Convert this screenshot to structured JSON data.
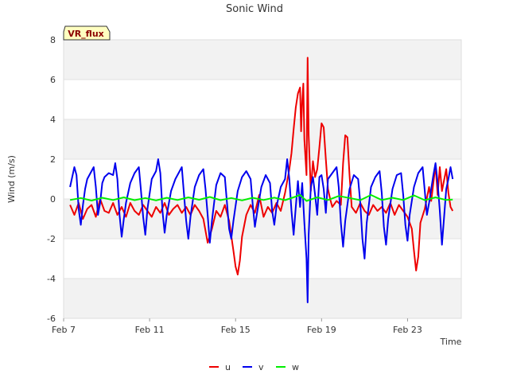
{
  "chart_data": {
    "type": "line",
    "title": "Sonic Wind",
    "xlabel": "Time",
    "ylabel": "Wind (m/s)",
    "badge": "VR_flux",
    "ylim": [
      -6,
      8
    ],
    "xlim": [
      0,
      18.5
    ],
    "yticks": [
      -6,
      -4,
      -2,
      0,
      2,
      4,
      6,
      8
    ],
    "xticks": [
      {
        "value": 0,
        "label": "Feb 7"
      },
      {
        "value": 4,
        "label": "Feb 11"
      },
      {
        "value": 8,
        "label": "Feb 15"
      },
      {
        "value": 12,
        "label": "Feb 19"
      },
      {
        "value": 16,
        "label": "Feb 23"
      }
    ],
    "grid": "alternating horizontal bands",
    "legend_position": "bottom-center",
    "series": [
      {
        "name": "u",
        "color": "#ee0000",
        "points": [
          [
            0.3,
            -0.3
          ],
          [
            0.5,
            -0.8
          ],
          [
            0.7,
            -0.2
          ],
          [
            0.9,
            -1.0
          ],
          [
            1.1,
            -0.5
          ],
          [
            1.3,
            -0.3
          ],
          [
            1.5,
            -0.9
          ],
          [
            1.7,
            0.0
          ],
          [
            1.9,
            -0.6
          ],
          [
            2.1,
            -0.7
          ],
          [
            2.3,
            -0.2
          ],
          [
            2.5,
            -0.8
          ],
          [
            2.7,
            -0.4
          ],
          [
            2.9,
            -0.9
          ],
          [
            3.1,
            -0.2
          ],
          [
            3.3,
            -0.6
          ],
          [
            3.5,
            -0.8
          ],
          [
            3.7,
            -0.3
          ],
          [
            3.9,
            -0.6
          ],
          [
            4.1,
            -0.9
          ],
          [
            4.3,
            -0.4
          ],
          [
            4.5,
            -0.7
          ],
          [
            4.7,
            -0.2
          ],
          [
            4.9,
            -0.8
          ],
          [
            5.1,
            -0.5
          ],
          [
            5.3,
            -0.3
          ],
          [
            5.5,
            -0.7
          ],
          [
            5.7,
            -0.4
          ],
          [
            5.9,
            -0.8
          ],
          [
            6.1,
            -0.3
          ],
          [
            6.3,
            -0.6
          ],
          [
            6.5,
            -1.0
          ],
          [
            6.7,
            -2.2
          ],
          [
            6.9,
            -1.5
          ],
          [
            7.1,
            -0.6
          ],
          [
            7.3,
            -0.9
          ],
          [
            7.5,
            -0.3
          ],
          [
            7.7,
            -1.1
          ],
          [
            7.9,
            -2.6
          ],
          [
            8.0,
            -3.4
          ],
          [
            8.1,
            -3.8
          ],
          [
            8.2,
            -3.1
          ],
          [
            8.3,
            -1.9
          ],
          [
            8.5,
            -0.8
          ],
          [
            8.7,
            -0.3
          ],
          [
            8.9,
            -0.7
          ],
          [
            9.1,
            0.2
          ],
          [
            9.3,
            -0.9
          ],
          [
            9.5,
            -0.4
          ],
          [
            9.7,
            -0.7
          ],
          [
            9.9,
            -0.2
          ],
          [
            10.1,
            -0.6
          ],
          [
            10.3,
            0.3
          ],
          [
            10.5,
            1.5
          ],
          [
            10.6,
            2.3
          ],
          [
            10.7,
            3.5
          ],
          [
            10.8,
            4.6
          ],
          [
            10.9,
            5.3
          ],
          [
            11.0,
            5.6
          ],
          [
            11.05,
            3.4
          ],
          [
            11.1,
            4.9
          ],
          [
            11.15,
            5.8
          ],
          [
            11.2,
            3.0
          ],
          [
            11.3,
            1.2
          ],
          [
            11.35,
            7.1
          ],
          [
            11.4,
            3.2
          ],
          [
            11.5,
            0.4
          ],
          [
            11.6,
            1.9
          ],
          [
            11.7,
            1.1
          ],
          [
            11.8,
            1.5
          ],
          [
            11.9,
            2.6
          ],
          [
            12.0,
            3.8
          ],
          [
            12.1,
            3.6
          ],
          [
            12.2,
            2.0
          ],
          [
            12.3,
            0.5
          ],
          [
            12.4,
            0.0
          ],
          [
            12.5,
            -0.4
          ],
          [
            12.7,
            -0.1
          ],
          [
            12.9,
            -0.3
          ],
          [
            13.0,
            1.8
          ],
          [
            13.1,
            3.2
          ],
          [
            13.2,
            3.1
          ],
          [
            13.3,
            1.2
          ],
          [
            13.4,
            -0.4
          ],
          [
            13.6,
            -0.7
          ],
          [
            13.8,
            -0.2
          ],
          [
            14.0,
            -0.6
          ],
          [
            14.2,
            -0.8
          ],
          [
            14.4,
            -0.3
          ],
          [
            14.6,
            -0.6
          ],
          [
            14.8,
            -0.4
          ],
          [
            15.0,
            -0.7
          ],
          [
            15.2,
            -0.2
          ],
          [
            15.4,
            -0.8
          ],
          [
            15.6,
            -0.3
          ],
          [
            15.8,
            -0.6
          ],
          [
            16.0,
            -0.9
          ],
          [
            16.2,
            -1.5
          ],
          [
            16.3,
            -2.6
          ],
          [
            16.4,
            -3.6
          ],
          [
            16.5,
            -2.9
          ],
          [
            16.6,
            -1.2
          ],
          [
            16.8,
            -0.5
          ],
          [
            17.0,
            0.6
          ],
          [
            17.1,
            -0.1
          ],
          [
            17.3,
            1.7
          ],
          [
            17.4,
            0.2
          ],
          [
            17.5,
            1.6
          ],
          [
            17.6,
            0.4
          ],
          [
            17.8,
            1.5
          ],
          [
            17.9,
            0.3
          ],
          [
            18.0,
            -0.4
          ],
          [
            18.1,
            -0.6
          ]
        ]
      },
      {
        "name": "v",
        "color": "#0000ee",
        "points": [
          [
            0.3,
            0.6
          ],
          [
            0.5,
            1.6
          ],
          [
            0.6,
            1.2
          ],
          [
            0.7,
            -0.5
          ],
          [
            0.8,
            -1.3
          ],
          [
            0.9,
            -0.3
          ],
          [
            1.0,
            0.5
          ],
          [
            1.1,
            1.0
          ],
          [
            1.3,
            1.4
          ],
          [
            1.4,
            1.6
          ],
          [
            1.5,
            0.6
          ],
          [
            1.6,
            -0.8
          ],
          [
            1.7,
            -0.2
          ],
          [
            1.8,
            0.8
          ],
          [
            1.9,
            1.1
          ],
          [
            2.1,
            1.3
          ],
          [
            2.3,
            1.2
          ],
          [
            2.4,
            1.8
          ],
          [
            2.5,
            1.0
          ],
          [
            2.6,
            -0.8
          ],
          [
            2.7,
            -1.9
          ],
          [
            2.8,
            -1.0
          ],
          [
            2.9,
            -0.2
          ],
          [
            3.1,
            0.8
          ],
          [
            3.3,
            1.3
          ],
          [
            3.5,
            1.6
          ],
          [
            3.6,
            0.4
          ],
          [
            3.7,
            -0.9
          ],
          [
            3.8,
            -1.8
          ],
          [
            3.9,
            -0.5
          ],
          [
            4.1,
            1.0
          ],
          [
            4.3,
            1.4
          ],
          [
            4.4,
            2.0
          ],
          [
            4.5,
            1.3
          ],
          [
            4.6,
            -0.6
          ],
          [
            4.7,
            -1.7
          ],
          [
            4.8,
            -0.8
          ],
          [
            5.0,
            0.4
          ],
          [
            5.2,
            1.0
          ],
          [
            5.4,
            1.4
          ],
          [
            5.5,
            1.6
          ],
          [
            5.6,
            0.2
          ],
          [
            5.7,
            -1.1
          ],
          [
            5.8,
            -2.0
          ],
          [
            5.9,
            -0.9
          ],
          [
            6.1,
            0.6
          ],
          [
            6.3,
            1.2
          ],
          [
            6.5,
            1.5
          ],
          [
            6.6,
            0.5
          ],
          [
            6.7,
            -0.8
          ],
          [
            6.8,
            -2.2
          ],
          [
            6.9,
            -1.1
          ],
          [
            7.1,
            0.7
          ],
          [
            7.3,
            1.3
          ],
          [
            7.5,
            1.1
          ],
          [
            7.6,
            -0.2
          ],
          [
            7.7,
            -1.5
          ],
          [
            7.8,
            -2.0
          ],
          [
            7.9,
            -1.1
          ],
          [
            8.1,
            0.4
          ],
          [
            8.3,
            1.1
          ],
          [
            8.5,
            1.4
          ],
          [
            8.7,
            1.0
          ],
          [
            8.8,
            -0.3
          ],
          [
            8.9,
            -1.4
          ],
          [
            9.0,
            -0.7
          ],
          [
            9.2,
            0.6
          ],
          [
            9.4,
            1.2
          ],
          [
            9.6,
            0.8
          ],
          [
            9.7,
            -0.6
          ],
          [
            9.8,
            -1.3
          ],
          [
            9.9,
            -0.4
          ],
          [
            10.1,
            0.6
          ],
          [
            10.3,
            1.0
          ],
          [
            10.4,
            2.0
          ],
          [
            10.5,
            1.0
          ],
          [
            10.6,
            -0.6
          ],
          [
            10.7,
            -1.8
          ],
          [
            10.8,
            -0.4
          ],
          [
            10.9,
            0.9
          ],
          [
            11.0,
            -0.4
          ],
          [
            11.1,
            0.8
          ],
          [
            11.2,
            -1.2
          ],
          [
            11.3,
            -3.0
          ],
          [
            11.35,
            -5.2
          ],
          [
            11.4,
            -1.8
          ],
          [
            11.5,
            0.6
          ],
          [
            11.6,
            1.1
          ],
          [
            11.7,
            0.2
          ],
          [
            11.8,
            -0.8
          ],
          [
            11.9,
            1.1
          ],
          [
            12.0,
            1.2
          ],
          [
            12.1,
            0.5
          ],
          [
            12.2,
            -0.7
          ],
          [
            12.3,
            1.0
          ],
          [
            12.5,
            1.3
          ],
          [
            12.7,
            1.6
          ],
          [
            12.8,
            0.6
          ],
          [
            12.9,
            -1.2
          ],
          [
            13.0,
            -2.4
          ],
          [
            13.1,
            -1.1
          ],
          [
            13.3,
            0.5
          ],
          [
            13.5,
            1.2
          ],
          [
            13.7,
            1.0
          ],
          [
            13.8,
            -0.2
          ],
          [
            13.9,
            -2.0
          ],
          [
            14.0,
            -3.0
          ],
          [
            14.1,
            -1.2
          ],
          [
            14.3,
            0.6
          ],
          [
            14.5,
            1.1
          ],
          [
            14.7,
            1.4
          ],
          [
            14.8,
            0.3
          ],
          [
            14.9,
            -1.4
          ],
          [
            15.0,
            -2.3
          ],
          [
            15.1,
            -1.0
          ],
          [
            15.3,
            0.5
          ],
          [
            15.5,
            1.2
          ],
          [
            15.7,
            1.3
          ],
          [
            15.8,
            0.2
          ],
          [
            15.9,
            -1.3
          ],
          [
            16.0,
            -2.1
          ],
          [
            16.1,
            -0.8
          ],
          [
            16.3,
            0.6
          ],
          [
            16.5,
            1.3
          ],
          [
            16.7,
            1.6
          ],
          [
            16.8,
            0.4
          ],
          [
            16.9,
            -0.8
          ],
          [
            17.0,
            -0.2
          ],
          [
            17.2,
            1.2
          ],
          [
            17.3,
            1.8
          ],
          [
            17.4,
            0.8
          ],
          [
            17.5,
            -0.6
          ],
          [
            17.6,
            -2.3
          ],
          [
            17.7,
            -0.9
          ],
          [
            17.8,
            0.5
          ],
          [
            17.9,
            1.0
          ],
          [
            18.0,
            1.6
          ],
          [
            18.1,
            1.0
          ]
        ]
      },
      {
        "name": "w",
        "color": "#00ee00",
        "points": [
          [
            0.3,
            -0.05
          ],
          [
            0.8,
            0.05
          ],
          [
            1.3,
            -0.08
          ],
          [
            1.8,
            0.06
          ],
          [
            2.3,
            -0.05
          ],
          [
            2.8,
            0.08
          ],
          [
            3.3,
            -0.06
          ],
          [
            3.8,
            0.05
          ],
          [
            4.3,
            -0.07
          ],
          [
            4.8,
            0.06
          ],
          [
            5.3,
            -0.05
          ],
          [
            5.8,
            0.08
          ],
          [
            6.3,
            -0.04
          ],
          [
            6.8,
            0.1
          ],
          [
            7.3,
            -0.06
          ],
          [
            7.8,
            0.05
          ],
          [
            8.3,
            -0.07
          ],
          [
            8.8,
            0.06
          ],
          [
            9.3,
            -0.05
          ],
          [
            9.8,
            0.07
          ],
          [
            10.3,
            -0.06
          ],
          [
            10.8,
            0.12
          ],
          [
            11.0,
            0.2
          ],
          [
            11.3,
            -0.1
          ],
          [
            11.8,
            0.08
          ],
          [
            12.3,
            -0.05
          ],
          [
            12.8,
            0.15
          ],
          [
            13.3,
            0.05
          ],
          [
            13.8,
            -0.06
          ],
          [
            14.3,
            0.2
          ],
          [
            14.8,
            -0.05
          ],
          [
            15.3,
            0.06
          ],
          [
            15.8,
            -0.05
          ],
          [
            16.3,
            0.18
          ],
          [
            16.8,
            -0.06
          ],
          [
            17.3,
            0.08
          ],
          [
            17.8,
            -0.05
          ],
          [
            18.1,
            -0.03
          ]
        ]
      }
    ]
  }
}
